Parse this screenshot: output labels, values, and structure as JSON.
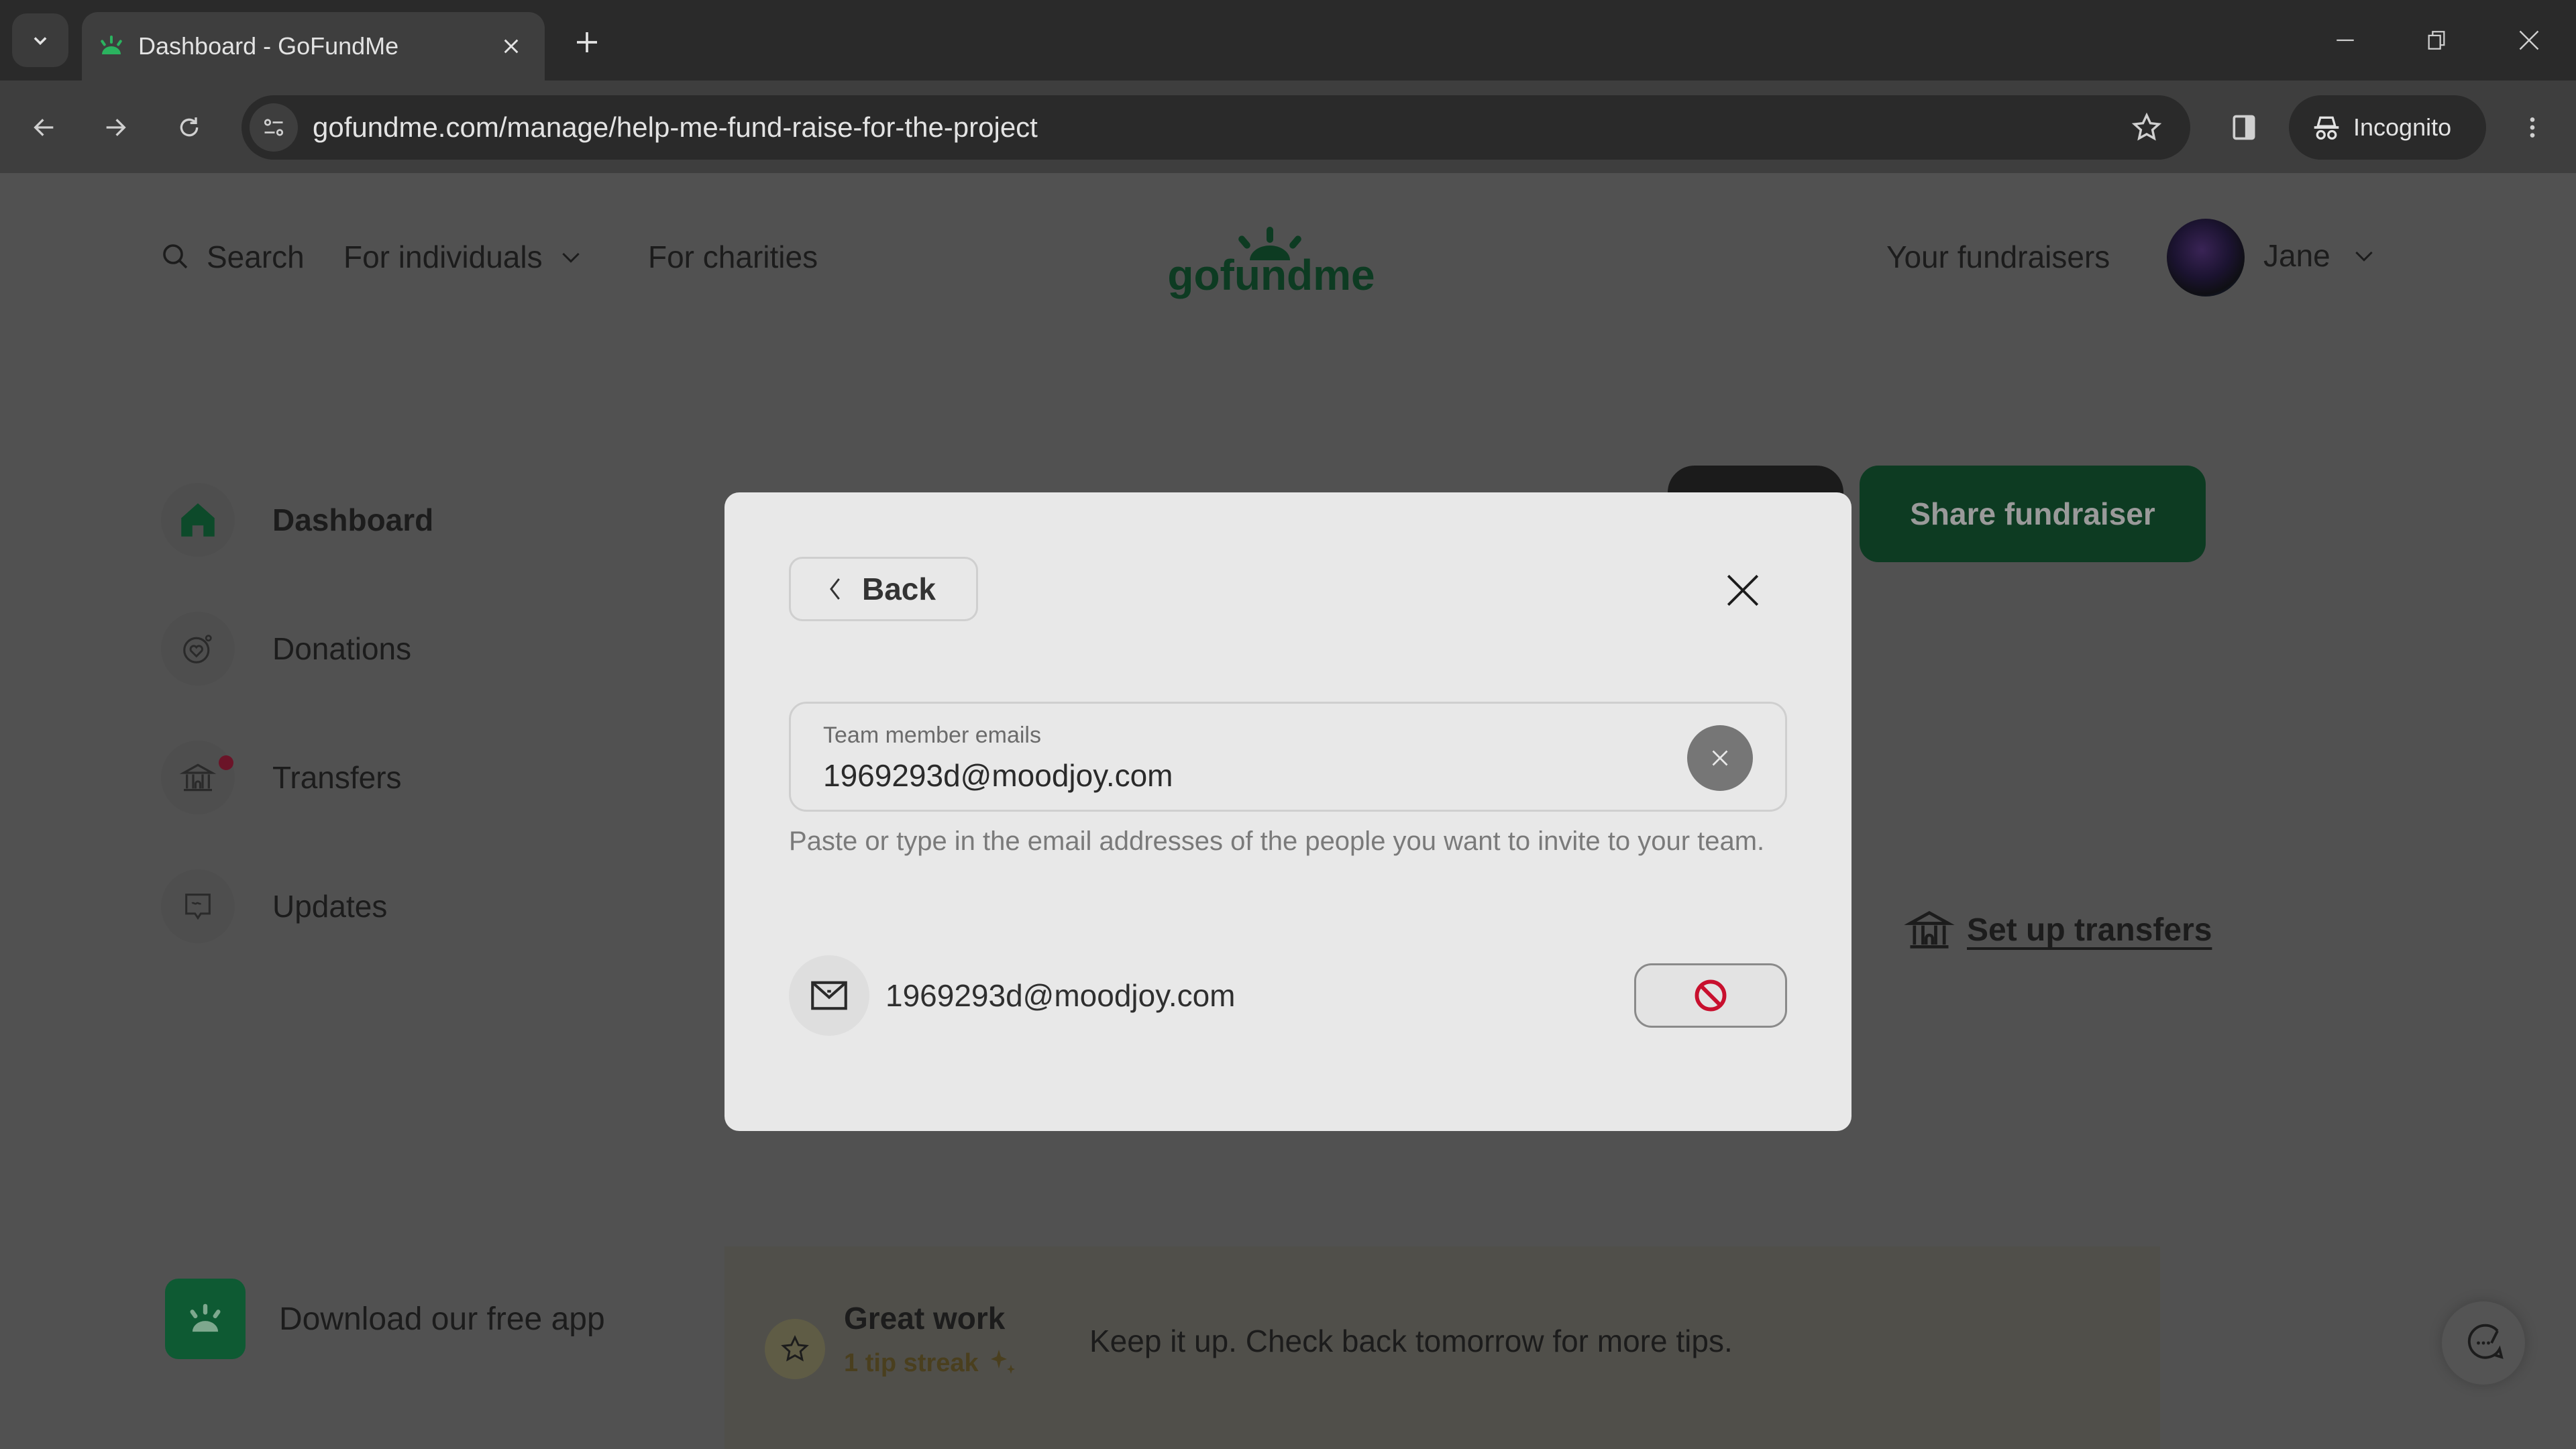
{
  "browser": {
    "tab": {
      "title": "Dashboard - GoFundMe"
    },
    "url": "gofundme.com/manage/help-me-fund-raise-for-the-project",
    "profile_label": "Incognito"
  },
  "header": {
    "search_label": "Search",
    "for_individuals_label": "For individuals",
    "for_charities_label": "For charities",
    "logo_text": "gofundme",
    "your_fundraisers_label": "Your fundraisers",
    "user_name": "Jane"
  },
  "sidebar": {
    "items": [
      {
        "label": "Dashboard",
        "icon": "home-icon",
        "active": true
      },
      {
        "label": "Donations",
        "icon": "donations-heart-icon",
        "active": false
      },
      {
        "label": "Transfers",
        "icon": "bank-icon",
        "active": false,
        "notification": true
      },
      {
        "label": "Updates",
        "icon": "updates-message-icon",
        "active": false
      }
    ],
    "download_app_label": "Download our free app"
  },
  "main": {
    "share_fundraiser_label": "Share fundraiser",
    "setup_transfers_label": "Set up transfers",
    "tip": {
      "title": "Great work",
      "streak": "1 tip streak",
      "message": "Keep it up. Check back tomorrow for more tips."
    }
  },
  "modal": {
    "back_label": "Back",
    "email_field": {
      "label": "Team member emails",
      "value": "1969293d@moodjoy.com"
    },
    "helper_text": "Paste or type in the email addresses of the people you want to invite to your team.",
    "invitees": [
      {
        "email": "1969293d@moodjoy.com",
        "status": "invalid"
      }
    ]
  },
  "colors": {
    "brand_green": "#0e5a33",
    "danger_red": "#c8102e",
    "overlay": "#515151",
    "modal_bg": "#e8e8e8"
  }
}
